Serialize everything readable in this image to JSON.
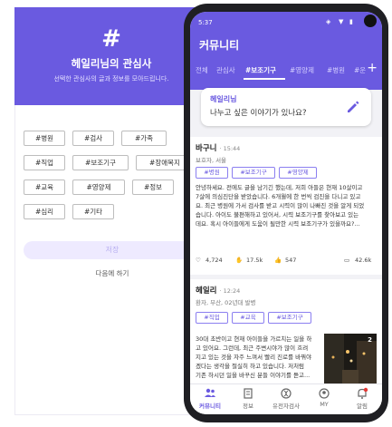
{
  "interests": {
    "hash_symbol": "#",
    "title": "헤일리님의 관심사",
    "subtitle": "선택한 관심사의 글과 정보를 모아드립니다.",
    "chips": [
      "#병원",
      "#검사",
      "#가족",
      "#직업",
      "#보조기구",
      "#장애복지",
      "#교육",
      "#영양제",
      "#정보",
      "#심리",
      "#기타"
    ],
    "save_label": "저장",
    "later_label": "다음에 하기"
  },
  "status_bar": {
    "time": "5:37"
  },
  "app": {
    "title": "커뮤니티",
    "tabs": [
      "전체",
      "관심사",
      "#보조기구",
      "#영양제",
      "#병원",
      "#운"
    ],
    "active_tab": "#보조기구",
    "plus_label": "+"
  },
  "prompt": {
    "name": "헤일리님",
    "text": "나누고 싶은 이야기가 있나요?"
  },
  "posts": [
    {
      "author": "바구니",
      "time": "· 15:44",
      "meta": "보호자, 서울",
      "tags": [
        "#병원",
        "#보조기구",
        "#영양제"
      ],
      "body": "안녕하세요. 전에도 글을 남기긴 했는데, 저희 아들은 현재 10살이고\n7살에 의심진단을 받았습니다. 6개월에 한 번씩 검진을 다니고 있고\n요. 최근 병원에 가서 검사를 받고 시력이 많이 나빠진 것을 알게 되었\n습니다. 아이도 불편해하고 있어서, 시력 보조기구를 찾아보고 있는\n데요. 혹시 아이들에게 도움이 될만한 시력 보조기구가 있을까요?...",
      "stats": {
        "likes": "4,724",
        "claps": "17.5k",
        "thumbs": "547",
        "comments": "42.6k"
      }
    },
    {
      "author": "헤일리",
      "time": "· 12:24",
      "meta": "환자, 부산, 02년대 발병",
      "tags": [
        "#직업",
        "#교육",
        "#보조기구"
      ],
      "body": "30대 초반이고 현재 아이들을 가르치는 일을 하\n고 있어요. 그런데, 최근 주변시야가 많이 흐려\n지고 있는 것을 자주 느껴서 빨리 진로를 바꿔야\n겠다는 생각을 절실히 하고 있습니다. 저처럼\n기존 하시던 일을 바꾸신 분들 이야기를 듣고...",
      "image_count": "2"
    }
  ],
  "bottom_nav": [
    "커뮤니티",
    "정보",
    "유전자검사",
    "MY",
    "알림"
  ],
  "colors": {
    "primary": "#6a5ae0",
    "tag_border": "#8b7ff0",
    "notification": "#e53935"
  }
}
